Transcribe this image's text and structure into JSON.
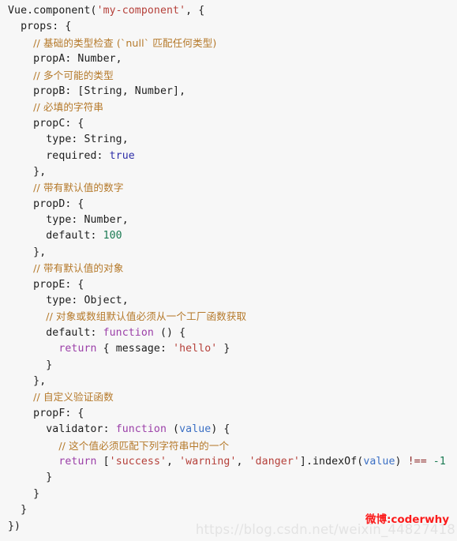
{
  "editor": {
    "language": "javascript",
    "background_color": "#f7f7f7",
    "theme_colors": {
      "plain": "#1c1c1c",
      "string": "#b5403a",
      "comment": "#b5792a",
      "keyword": "#9b3fa8",
      "boolean": "#2f2fa8",
      "number": "#1a7a52",
      "parameter": "#3b6fc4",
      "operator": "#8d2a2a"
    },
    "lines": [
      [
        {
          "text": "Vue.component(",
          "type": "plain"
        },
        {
          "text": "'my-component'",
          "type": "string"
        },
        {
          "text": ", {",
          "type": "plain"
        }
      ],
      [
        {
          "text": "  props: {",
          "type": "plain"
        }
      ],
      [
        {
          "text": "    ",
          "type": "plain"
        },
        {
          "text": "// 基础的类型检查 (`null` 匹配任何类型)",
          "type": "comment"
        }
      ],
      [
        {
          "text": "    propA: Number,",
          "type": "plain"
        }
      ],
      [
        {
          "text": "    ",
          "type": "plain"
        },
        {
          "text": "// 多个可能的类型",
          "type": "comment"
        }
      ],
      [
        {
          "text": "    propB: [String, Number],",
          "type": "plain"
        }
      ],
      [
        {
          "text": "    ",
          "type": "plain"
        },
        {
          "text": "// 必填的字符串",
          "type": "comment"
        }
      ],
      [
        {
          "text": "    propC: {",
          "type": "plain"
        }
      ],
      [
        {
          "text": "      type: String,",
          "type": "plain"
        }
      ],
      [
        {
          "text": "      required: ",
          "type": "plain"
        },
        {
          "text": "true",
          "type": "boolean"
        }
      ],
      [
        {
          "text": "    },",
          "type": "plain"
        }
      ],
      [
        {
          "text": "    ",
          "type": "plain"
        },
        {
          "text": "// 带有默认值的数字",
          "type": "comment"
        }
      ],
      [
        {
          "text": "    propD: {",
          "type": "plain"
        }
      ],
      [
        {
          "text": "      type: Number,",
          "type": "plain"
        }
      ],
      [
        {
          "text": "      default: ",
          "type": "plain"
        },
        {
          "text": "100",
          "type": "number"
        }
      ],
      [
        {
          "text": "    },",
          "type": "plain"
        }
      ],
      [
        {
          "text": "    ",
          "type": "plain"
        },
        {
          "text": "// 带有默认值的对象",
          "type": "comment"
        }
      ],
      [
        {
          "text": "    propE: {",
          "type": "plain"
        }
      ],
      [
        {
          "text": "      type: Object,",
          "type": "plain"
        }
      ],
      [
        {
          "text": "      ",
          "type": "plain"
        },
        {
          "text": "// 对象或数组默认值必须从一个工厂函数获取",
          "type": "comment"
        }
      ],
      [
        {
          "text": "      default: ",
          "type": "plain"
        },
        {
          "text": "function",
          "type": "keyword"
        },
        {
          "text": " () {",
          "type": "plain"
        }
      ],
      [
        {
          "text": "        ",
          "type": "plain"
        },
        {
          "text": "return",
          "type": "keyword"
        },
        {
          "text": " { message: ",
          "type": "plain"
        },
        {
          "text": "'hello'",
          "type": "string"
        },
        {
          "text": " }",
          "type": "plain"
        }
      ],
      [
        {
          "text": "      }",
          "type": "plain"
        }
      ],
      [
        {
          "text": "    },",
          "type": "plain"
        }
      ],
      [
        {
          "text": "    ",
          "type": "plain"
        },
        {
          "text": "// 自定义验证函数",
          "type": "comment"
        }
      ],
      [
        {
          "text": "    propF: {",
          "type": "plain"
        }
      ],
      [
        {
          "text": "      validator: ",
          "type": "plain"
        },
        {
          "text": "function",
          "type": "keyword"
        },
        {
          "text": " (",
          "type": "plain"
        },
        {
          "text": "value",
          "type": "parameter"
        },
        {
          "text": ") {",
          "type": "plain"
        }
      ],
      [
        {
          "text": "        ",
          "type": "plain"
        },
        {
          "text": "// 这个值必须匹配下列字符串中的一个",
          "type": "comment"
        }
      ],
      [
        {
          "text": "        ",
          "type": "plain"
        },
        {
          "text": "return",
          "type": "keyword"
        },
        {
          "text": " [",
          "type": "plain"
        },
        {
          "text": "'success'",
          "type": "string"
        },
        {
          "text": ", ",
          "type": "plain"
        },
        {
          "text": "'warning'",
          "type": "string"
        },
        {
          "text": ", ",
          "type": "plain"
        },
        {
          "text": "'danger'",
          "type": "string"
        },
        {
          "text": "].indexOf(",
          "type": "plain"
        },
        {
          "text": "value",
          "type": "parameter"
        },
        {
          "text": ") ",
          "type": "plain"
        },
        {
          "text": "!==",
          "type": "operator"
        },
        {
          "text": " ",
          "type": "plain"
        },
        {
          "text": "-1",
          "type": "number"
        }
      ],
      [
        {
          "text": "      }",
          "type": "plain"
        }
      ],
      [
        {
          "text": "    }",
          "type": "plain"
        }
      ],
      [
        {
          "text": "  }",
          "type": "plain"
        }
      ],
      [
        {
          "text": "})",
          "type": "plain"
        }
      ]
    ]
  },
  "watermarks": {
    "weibo": "微博:coderwhy",
    "url": "https://blog.csdn.net/weixin_44827418"
  }
}
